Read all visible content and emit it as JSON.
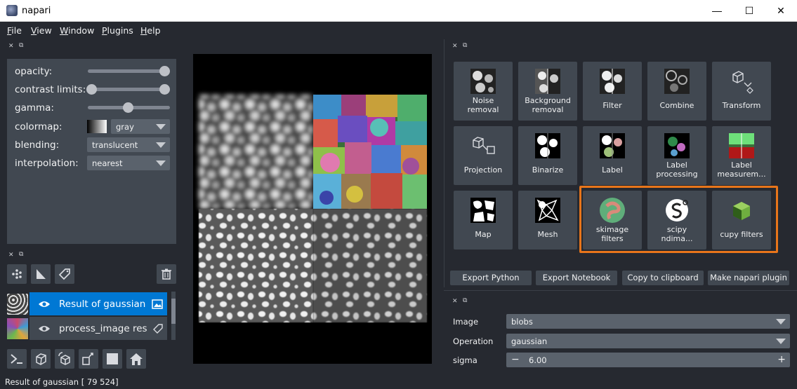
{
  "window": {
    "title": "napari",
    "minimize": "—",
    "maximize": "☐",
    "close": "✕"
  },
  "menu": [
    {
      "first": "F",
      "rest": "ile"
    },
    {
      "first": "V",
      "rest": "iew"
    },
    {
      "first": "W",
      "rest": "indow"
    },
    {
      "first": "P",
      "rest": "lugins"
    },
    {
      "first": "H",
      "rest": "elp"
    }
  ],
  "dock": {
    "close": "✕",
    "float": "⧉"
  },
  "layer_controls": {
    "opacity_label": "opacity:",
    "opacity_value": 1.0,
    "contrast_label": "contrast limits:",
    "gamma_label": "gamma:",
    "colormap_label": "colormap:",
    "colormap_value": "gray",
    "blending_label": "blending:",
    "blending_value": "translucent",
    "interpolation_label": "interpolation:",
    "interpolation_value": "nearest"
  },
  "layer_buttons": [
    "points-icon",
    "shapes-icon",
    "labels-icon",
    "trash-icon"
  ],
  "layers": [
    {
      "name": "Result of gaussian",
      "selected": true,
      "type_icon": "image-icon"
    },
    {
      "name": "process_image resul",
      "selected": false,
      "type_icon": "labels-icon"
    }
  ],
  "viewer_buttons": [
    "console-icon",
    "ndisplay-icon",
    "roll-icon",
    "transpose-icon",
    "grid-icon",
    "home-icon"
  ],
  "tools": [
    {
      "label1": "Noise",
      "label2": "removal",
      "icon": "noise-removal-icon"
    },
    {
      "label1": "Background",
      "label2": "removal",
      "icon": "background-removal-icon"
    },
    {
      "label1": "Filter",
      "label2": "",
      "icon": "filter-icon"
    },
    {
      "label1": "Combine",
      "label2": "",
      "icon": "combine-icon"
    },
    {
      "label1": "Transform",
      "label2": "",
      "icon": "transform-icon"
    },
    {
      "label1": "Projection",
      "label2": "",
      "icon": "projection-icon"
    },
    {
      "label1": "Binarize",
      "label2": "",
      "icon": "binarize-icon"
    },
    {
      "label1": "Label",
      "label2": "",
      "icon": "label-icon"
    },
    {
      "label1": "Label",
      "label2": "processing",
      "icon": "label-processing-icon"
    },
    {
      "label1": "Label",
      "label2": "measurem...",
      "icon": "label-measurement-icon"
    },
    {
      "label1": "Map",
      "label2": "",
      "icon": "map-icon"
    },
    {
      "label1": "Mesh",
      "label2": "",
      "icon": "mesh-icon"
    },
    {
      "label1": "skimage",
      "label2": "filters",
      "icon": "skimage-icon"
    },
    {
      "label1": "scipy",
      "label2": "ndima...",
      "icon": "scipy-icon"
    },
    {
      "label1": "cupy filters",
      "label2": "",
      "icon": "cupy-icon"
    }
  ],
  "export_buttons": [
    "Export Python",
    "Export Notebook",
    "Copy to clipboard",
    "Make napari plugin"
  ],
  "params": {
    "image_label": "Image",
    "image_value": "blobs",
    "operation_label": "Operation",
    "operation_value": "gaussian",
    "sigma_label": "sigma",
    "sigma_value": "6.00",
    "minus": "−",
    "plus": "+"
  },
  "status": "Result of gaussian [ 79 524]",
  "colors": {
    "accent": "#0078d4",
    "highlight": "#e8751a",
    "panel": "#414851",
    "background": "#262930"
  }
}
